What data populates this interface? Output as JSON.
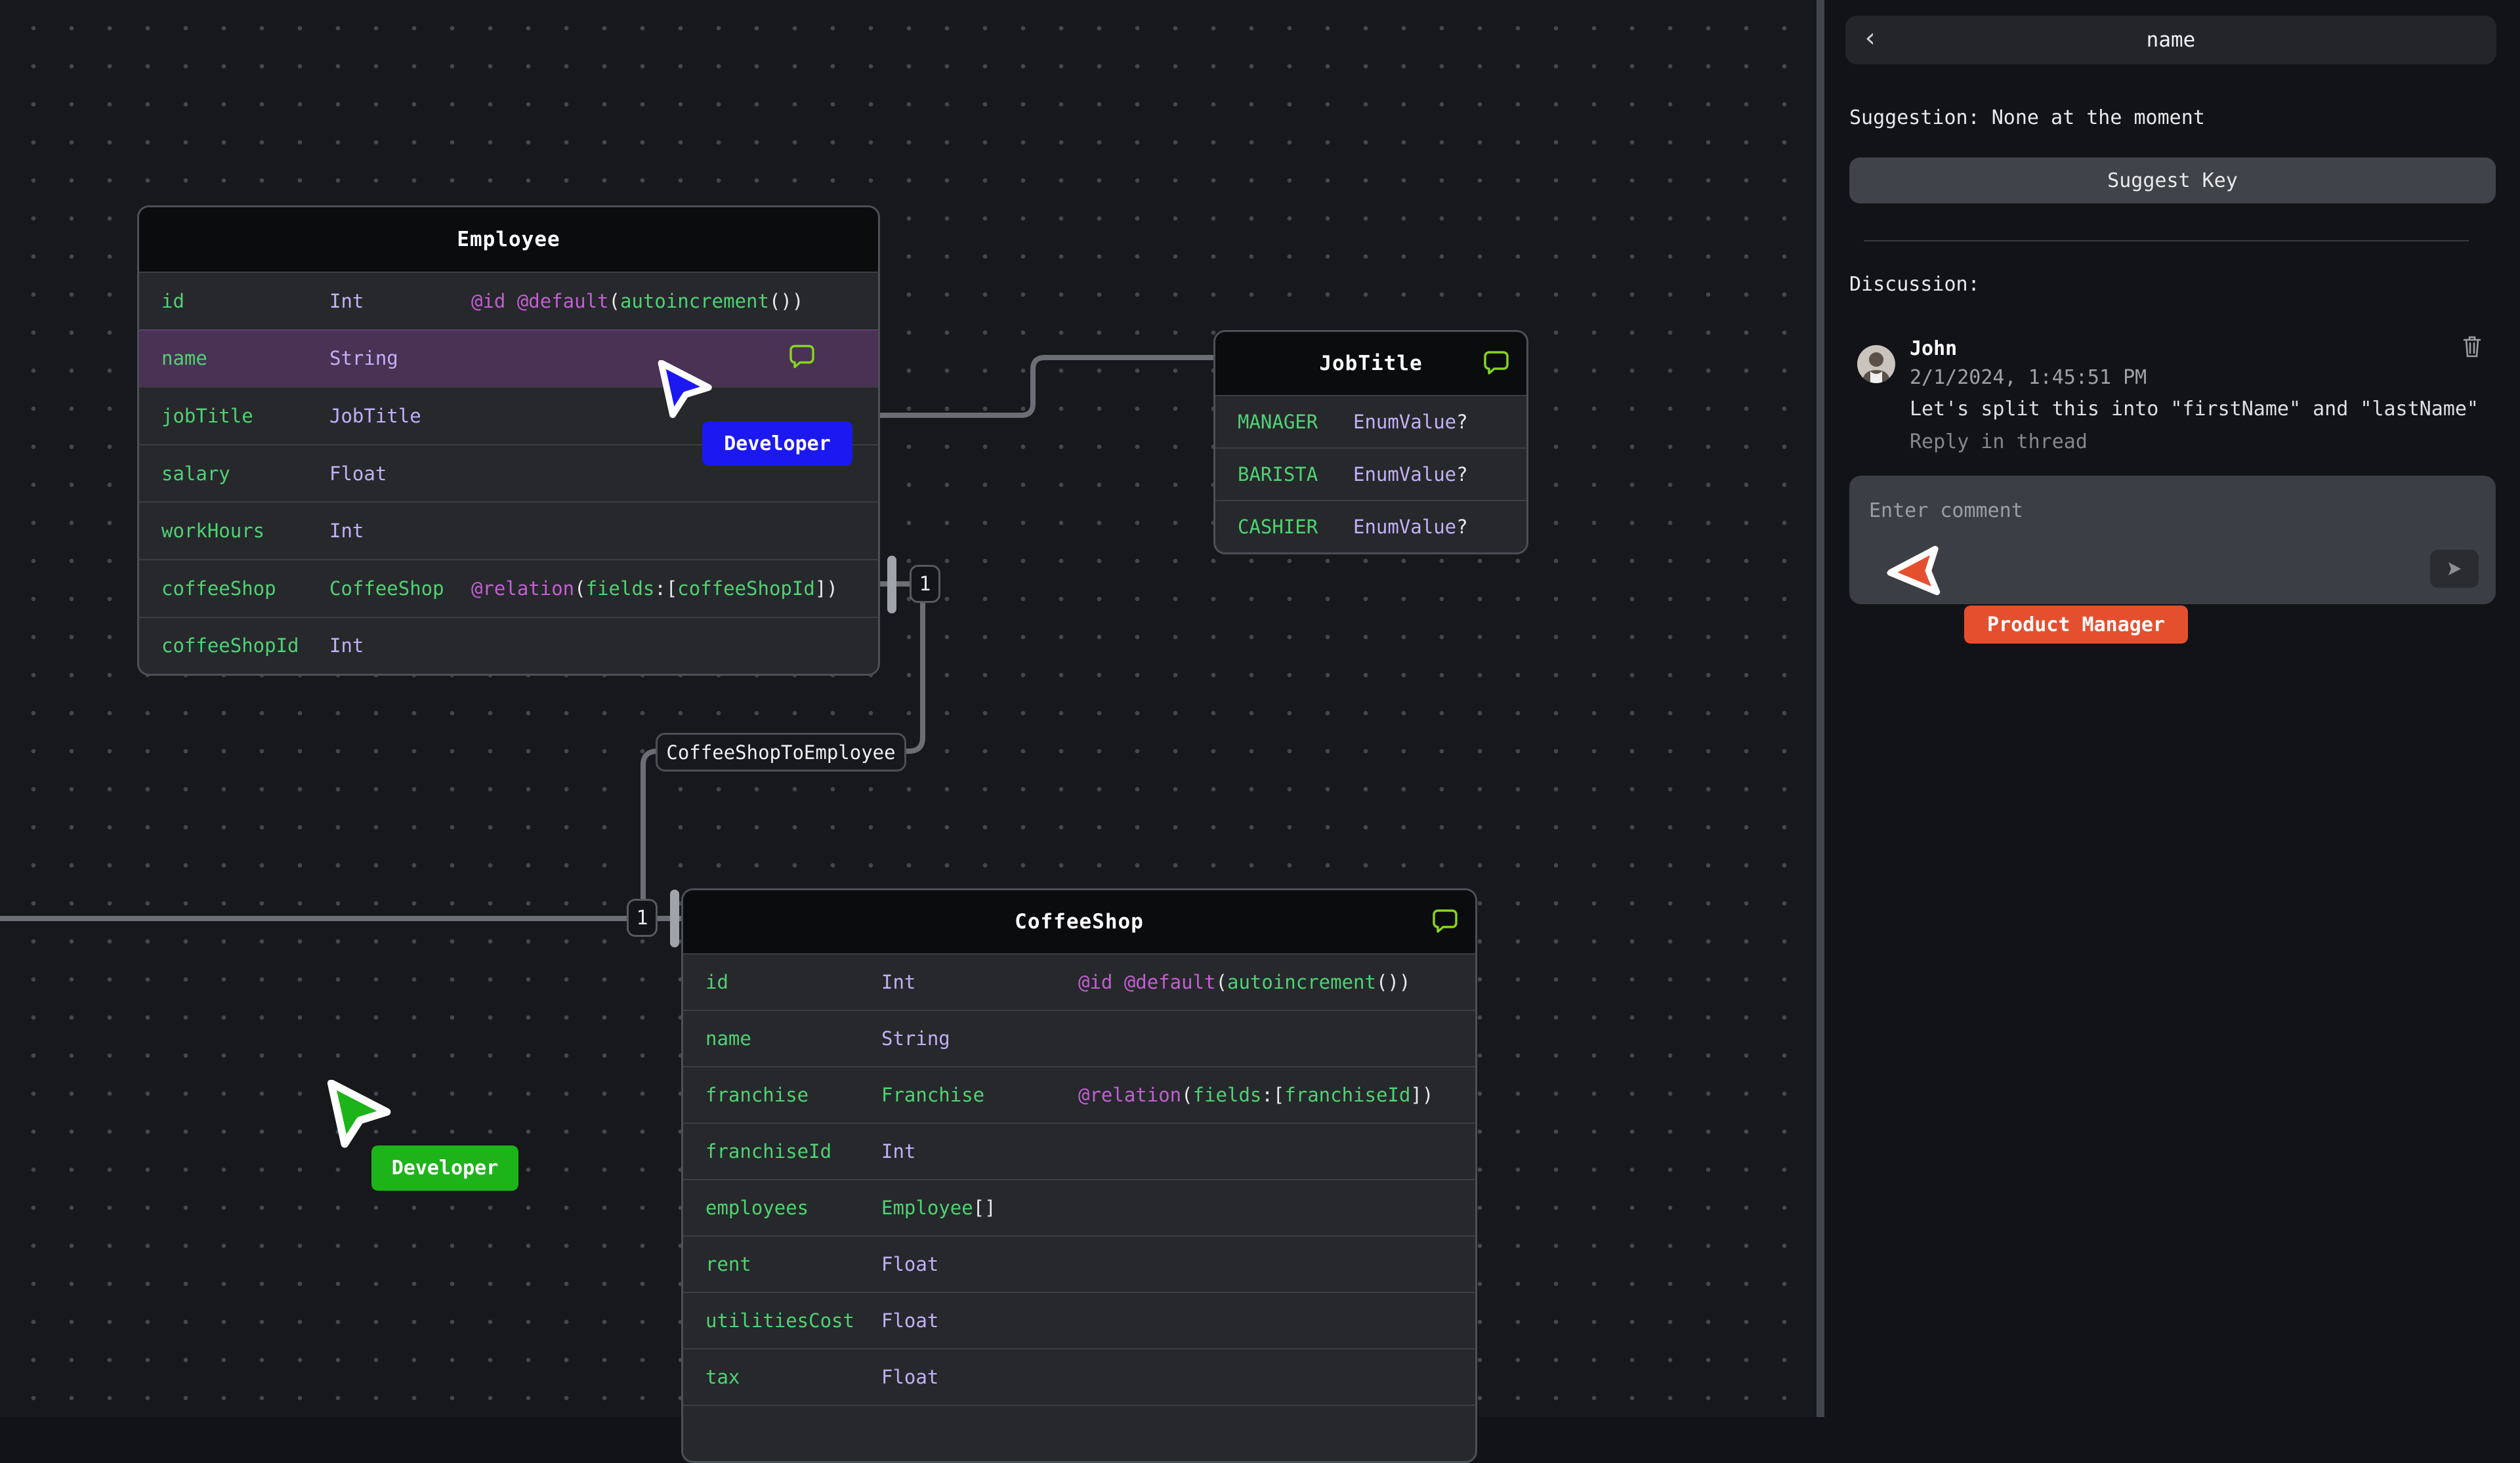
{
  "canvas": {
    "tables": [
      {
        "id": "employee",
        "title": "Employee",
        "header_comment_icon": false,
        "rows": [
          {
            "name": "id",
            "type": [
              [
                "Int",
                "t"
              ]
            ],
            "attr": [
              [
                "@id @default",
                "d"
              ],
              [
                "(",
                "p"
              ],
              [
                "autoincrement",
                "g"
              ],
              [
                "())",
                "p"
              ]
            ],
            "highlighted": false,
            "comment_icon": false
          },
          {
            "name": "name",
            "type": [
              [
                "String",
                "t"
              ]
            ],
            "attr": [],
            "highlighted": true,
            "comment_icon": true
          },
          {
            "name": "jobTitle",
            "type": [
              [
                "JobTitle",
                "t"
              ]
            ],
            "attr": [],
            "highlighted": false,
            "comment_icon": false
          },
          {
            "name": "salary",
            "type": [
              [
                "Float",
                "t"
              ]
            ],
            "attr": [],
            "highlighted": false,
            "comment_icon": false
          },
          {
            "name": "workHours",
            "type": [
              [
                "Int",
                "t"
              ]
            ],
            "attr": [],
            "highlighted": false,
            "comment_icon": false
          },
          {
            "name": "coffeeShop",
            "type": [
              [
                "CoffeeShop",
                "g"
              ]
            ],
            "attr": [
              [
                "@relation",
                "d"
              ],
              [
                "(",
                "p"
              ],
              [
                "fields",
                "g"
              ],
              [
                ":[",
                "p"
              ],
              [
                "coffeeShopId",
                "g"
              ],
              [
                "])",
                "p"
              ]
            ],
            "highlighted": false,
            "comment_icon": false
          },
          {
            "name": "coffeeShopId",
            "type": [
              [
                "Int",
                "t"
              ]
            ],
            "attr": [],
            "highlighted": false,
            "comment_icon": false
          }
        ]
      },
      {
        "id": "jobtitle",
        "title": "JobTitle",
        "header_comment_icon": true,
        "rows": [
          {
            "name": "MANAGER",
            "type": [
              [
                "EnumValue",
                "t"
              ],
              [
                "?",
                "p"
              ]
            ],
            "attr": [],
            "highlighted": false,
            "comment_icon": false
          },
          {
            "name": "BARISTA",
            "type": [
              [
                "EnumValue",
                "t"
              ],
              [
                "?",
                "p"
              ]
            ],
            "attr": [],
            "highlighted": false,
            "comment_icon": false
          },
          {
            "name": "CASHIER",
            "type": [
              [
                "EnumValue",
                "t"
              ],
              [
                "?",
                "p"
              ]
            ],
            "attr": [],
            "highlighted": false,
            "comment_icon": false
          }
        ]
      },
      {
        "id": "coffeeshop",
        "title": "CoffeeShop",
        "header_comment_icon": true,
        "rows": [
          {
            "name": "id",
            "type": [
              [
                "Int",
                "t"
              ]
            ],
            "attr": [
              [
                "@id @default",
                "d"
              ],
              [
                "(",
                "p"
              ],
              [
                "autoincrement",
                "g"
              ],
              [
                "())",
                "p"
              ]
            ],
            "highlighted": false,
            "comment_icon": false
          },
          {
            "name": "name",
            "type": [
              [
                "String",
                "t"
              ]
            ],
            "attr": [],
            "highlighted": false,
            "comment_icon": false
          },
          {
            "name": "franchise",
            "type": [
              [
                "Franchise",
                "g"
              ]
            ],
            "attr": [
              [
                "@relation",
                "d"
              ],
              [
                "(",
                "p"
              ],
              [
                "fields",
                "g"
              ],
              [
                ":[",
                "p"
              ],
              [
                "franchiseId",
                "g"
              ],
              [
                "])",
                "p"
              ]
            ],
            "highlighted": false,
            "comment_icon": false
          },
          {
            "name": "franchiseId",
            "type": [
              [
                "Int",
                "t"
              ]
            ],
            "attr": [],
            "highlighted": false,
            "comment_icon": false
          },
          {
            "name": "employees",
            "type": [
              [
                "Employee",
                "g"
              ],
              [
                "[]",
                "p"
              ]
            ],
            "attr": [],
            "highlighted": false,
            "comment_icon": false
          },
          {
            "name": "rent",
            "type": [
              [
                "Float",
                "t"
              ]
            ],
            "attr": [],
            "highlighted": false,
            "comment_icon": false
          },
          {
            "name": "utilitiesCost",
            "type": [
              [
                "Float",
                "t"
              ]
            ],
            "attr": [],
            "highlighted": false,
            "comment_icon": false
          },
          {
            "name": "tax",
            "type": [
              [
                "Float",
                "t"
              ]
            ],
            "attr": [],
            "highlighted": false,
            "comment_icon": false
          },
          {
            "name": "",
            "type": [],
            "attr": [],
            "highlighted": false,
            "comment_icon": false
          }
        ]
      }
    ],
    "relation_label": "CoffeeShopToEmployee",
    "badges": [
      "1",
      "1"
    ],
    "cursors": [
      {
        "label": "Developer",
        "color": "#1b18f2"
      },
      {
        "label": "Developer",
        "color": "#1db41a"
      },
      {
        "label": "Product Manager",
        "color": "#e4502e"
      }
    ],
    "colors": {
      "field_green": "#4fd273",
      "type_lavender": "#c2b0f5",
      "directive_magenta": "#c35fd2",
      "comment_bubble_lime": "#86d61e",
      "relation_line_gray": "#6b6e75",
      "row_highlight_purple": "#493254"
    }
  },
  "sidebar": {
    "back": "‹",
    "title": "name",
    "suggestion": "Suggestion: None at the moment",
    "suggest_key_label": "Suggest Key",
    "discussion_label": "Discussion:",
    "comment": {
      "author": "John",
      "timestamp": "2/1/2024, 1:45:51 PM",
      "message": "Let's split this into \"firstName\" and \"lastName\"",
      "reply": "Reply in thread"
    },
    "input": {
      "placeholder": "Enter comment"
    }
  }
}
